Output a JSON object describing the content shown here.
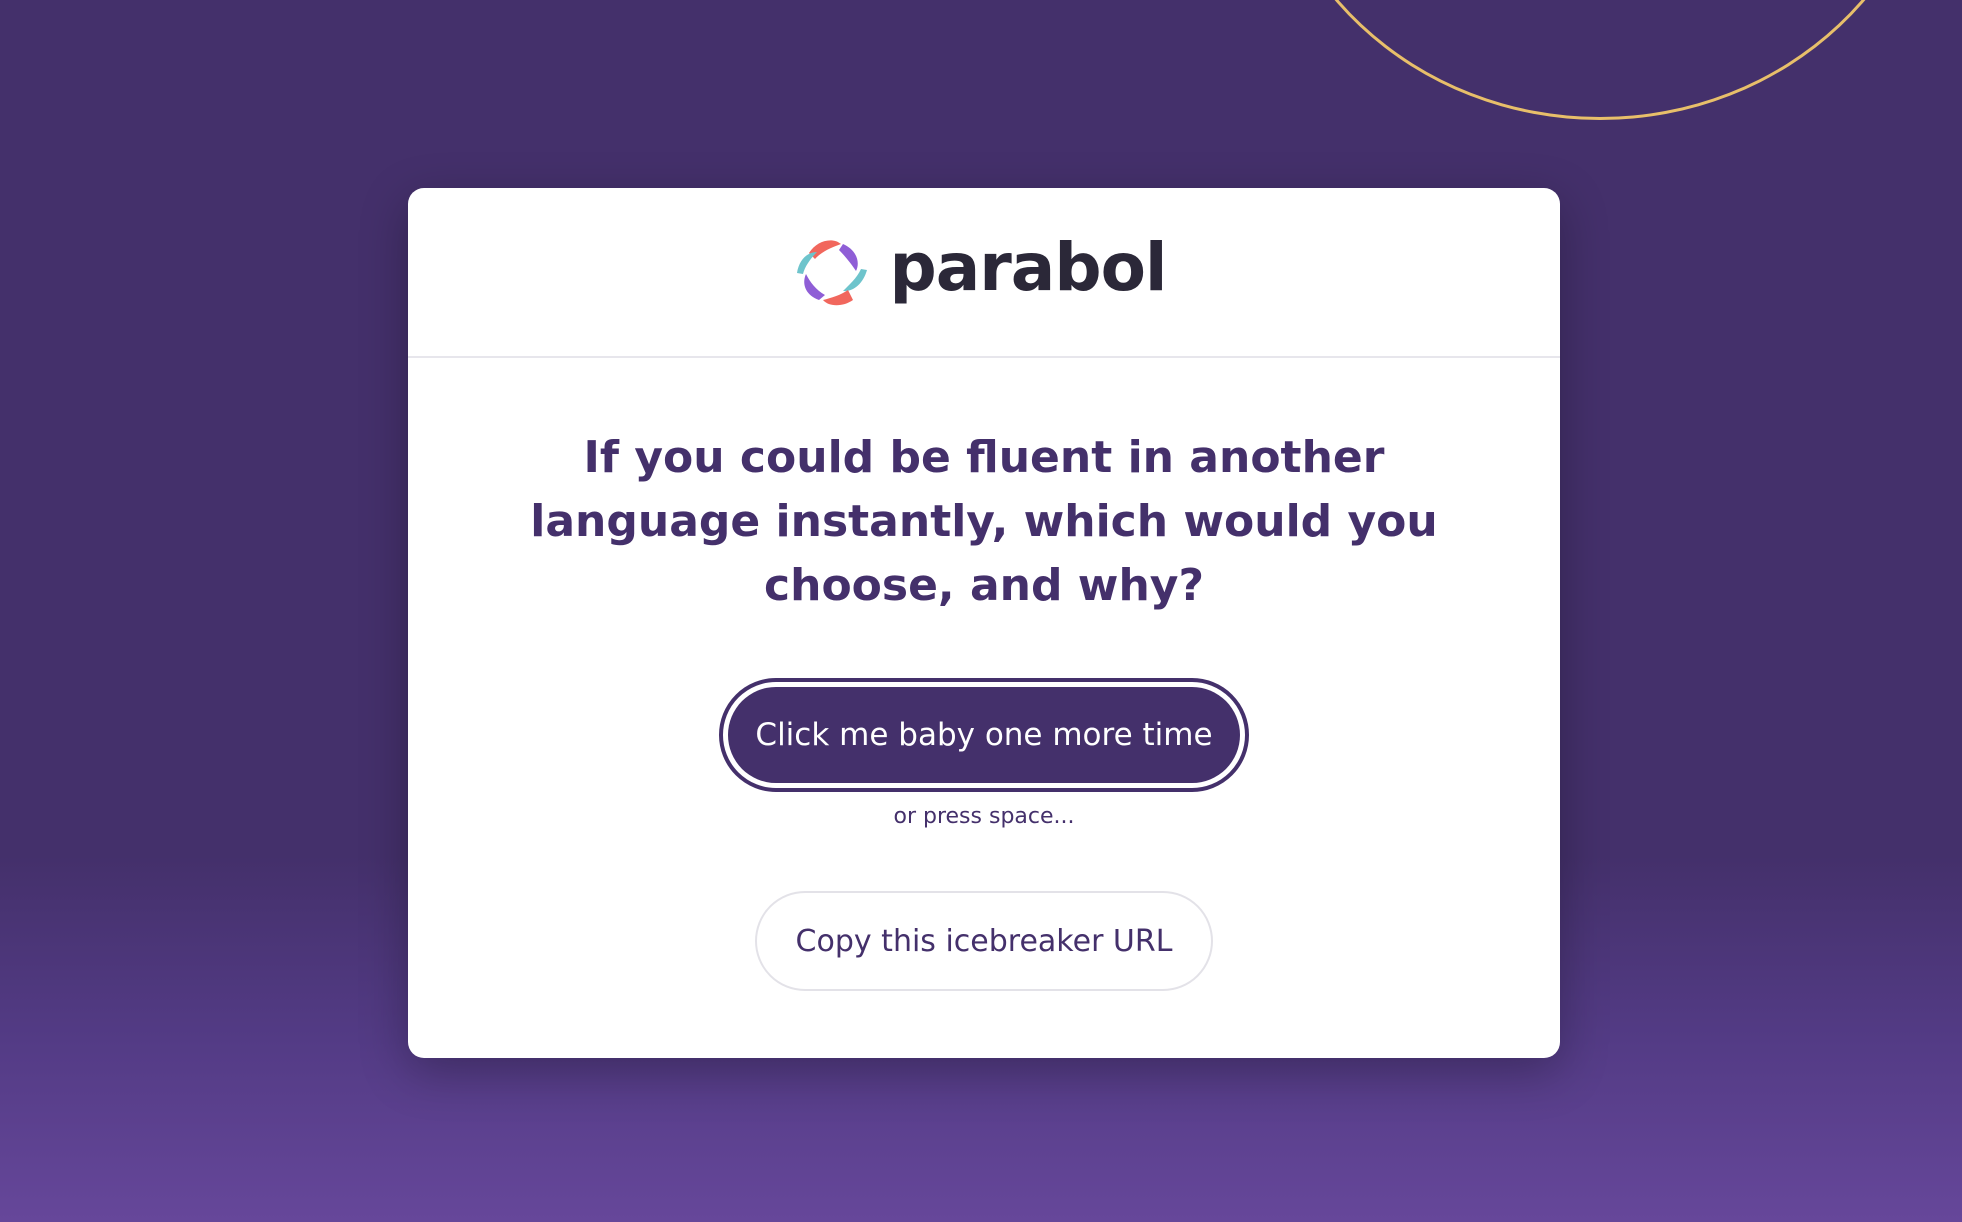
{
  "brand": {
    "name": "parabol",
    "logo_icon": "parabol-logo-icon",
    "colors": {
      "teal": "#6ec4cc",
      "purple": "#8f5ed6",
      "coral": "#f1675d"
    }
  },
  "icebreaker": {
    "prompt": "If you could be fluent in another language instantly, which would you choose, and why?"
  },
  "actions": {
    "primary_label": "Click me baby one more time",
    "hint": "or press space...",
    "copy_label": "Copy this icebreaker URL"
  },
  "theme": {
    "background": "#44306b",
    "accent_arc": "#e8bf6a",
    "primary": "#44306b",
    "card": "#ffffff"
  }
}
